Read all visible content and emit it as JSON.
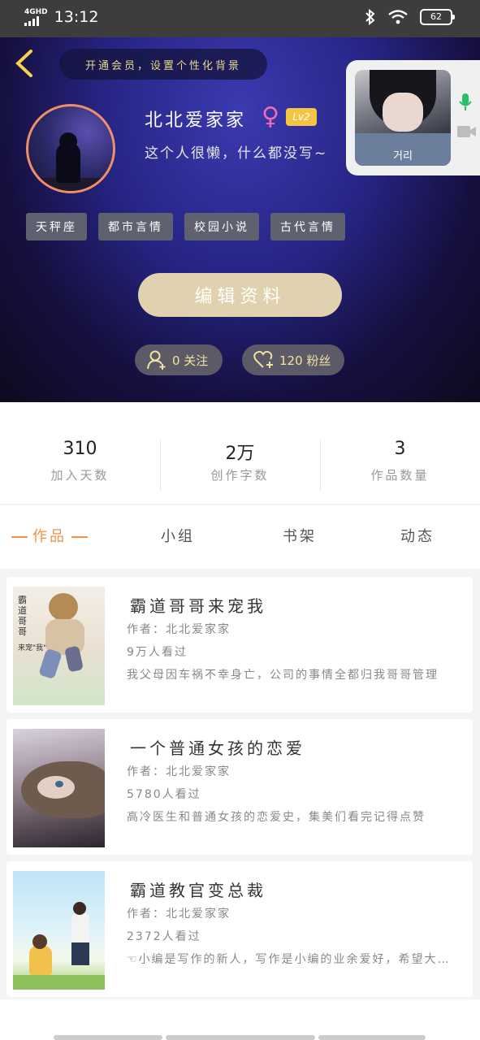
{
  "status_bar": {
    "network": "4GHD",
    "time": "13:12",
    "battery": "62"
  },
  "header": {
    "vip_prompt": "开通会员，设置个性化背景",
    "username": "北北爱家家",
    "level": "Lv2",
    "bio": "这个人很懒，什么都没写~",
    "tags": [
      "天秤座",
      "都市言情",
      "校园小说",
      "古代言情"
    ],
    "edit_button": "编辑资料",
    "following": "0 关注",
    "fans": "120 粉丝"
  },
  "video_call": {
    "caller_name": "거리"
  },
  "stats": [
    {
      "value": "310",
      "label": "加入天数"
    },
    {
      "value": "2万",
      "label": "创作字数"
    },
    {
      "value": "3",
      "label": "作品数量"
    }
  ],
  "tabs": [
    "作品",
    "小组",
    "书架",
    "动态"
  ],
  "works": [
    {
      "title": "霸道哥哥来宠我",
      "author": "作者：北北爱家家",
      "views": "9万人看过",
      "desc": "我父母因车祸不幸身亡，公司的事情全都归我哥哥管理",
      "cover_title": "霸道哥哥",
      "cover_sub": "来宠\"我\""
    },
    {
      "title": "一个普通女孩的恋爱",
      "author": "作者：北北爱家家",
      "views": "5780人看过",
      "desc": "高冷医生和普通女孩的恋爱史，集美们看完记得点赞",
      "cover_title": "",
      "cover_sub": ""
    },
    {
      "title": "霸道教官变总裁",
      "author": "作者：北北爱家家",
      "views": "2372人看过",
      "desc": "☜小编是写作的新人，写作是小编的业余爱好，希望大家喜欢",
      "cover_title": "",
      "cover_sub": ""
    }
  ]
}
